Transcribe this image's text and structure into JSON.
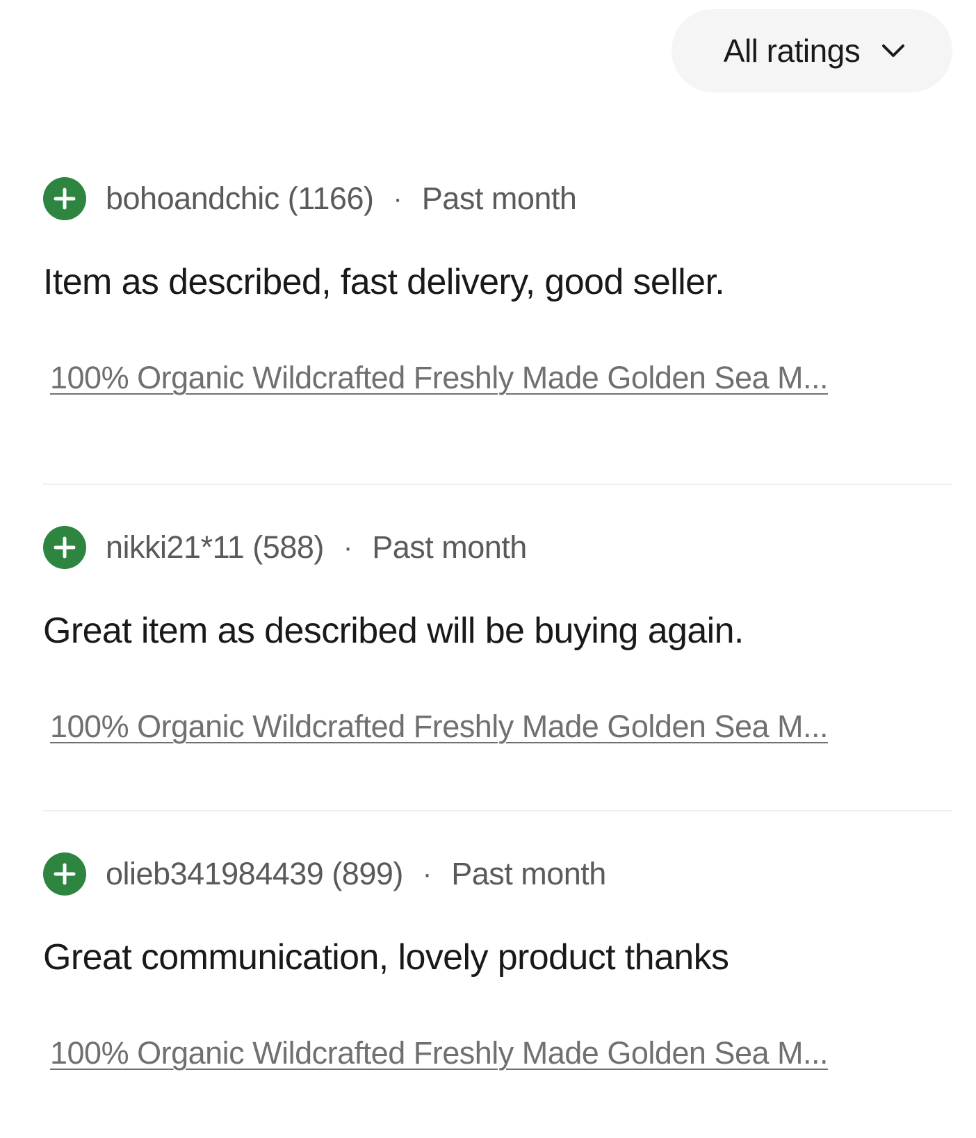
{
  "filter": {
    "label": "All ratings",
    "icon": "chevron-down-icon"
  },
  "reviews": [
    {
      "rating_icon": "positive-plus-icon",
      "rating_color": "#2e8540",
      "user": "bohoandchic (1166)",
      "separator": "·",
      "when": "Past month",
      "comment": "Item as described, fast delivery, good seller.",
      "item": "100% Organic Wildcrafted Freshly Made Golden Sea M..."
    },
    {
      "rating_icon": "positive-plus-icon",
      "rating_color": "#2e8540",
      "user": "nikki21*11 (588)",
      "separator": "·",
      "when": "Past month",
      "comment": "Great item as described will be buying again.",
      "item": "100% Organic Wildcrafted Freshly Made Golden Sea M..."
    },
    {
      "rating_icon": "positive-plus-icon",
      "rating_color": "#2e8540",
      "user": "olieb341984439 (899)",
      "separator": "·",
      "when": "Past month",
      "comment": "Great communication, lovely product thanks",
      "item": "100% Organic Wildcrafted Freshly Made Golden Sea M..."
    }
  ]
}
